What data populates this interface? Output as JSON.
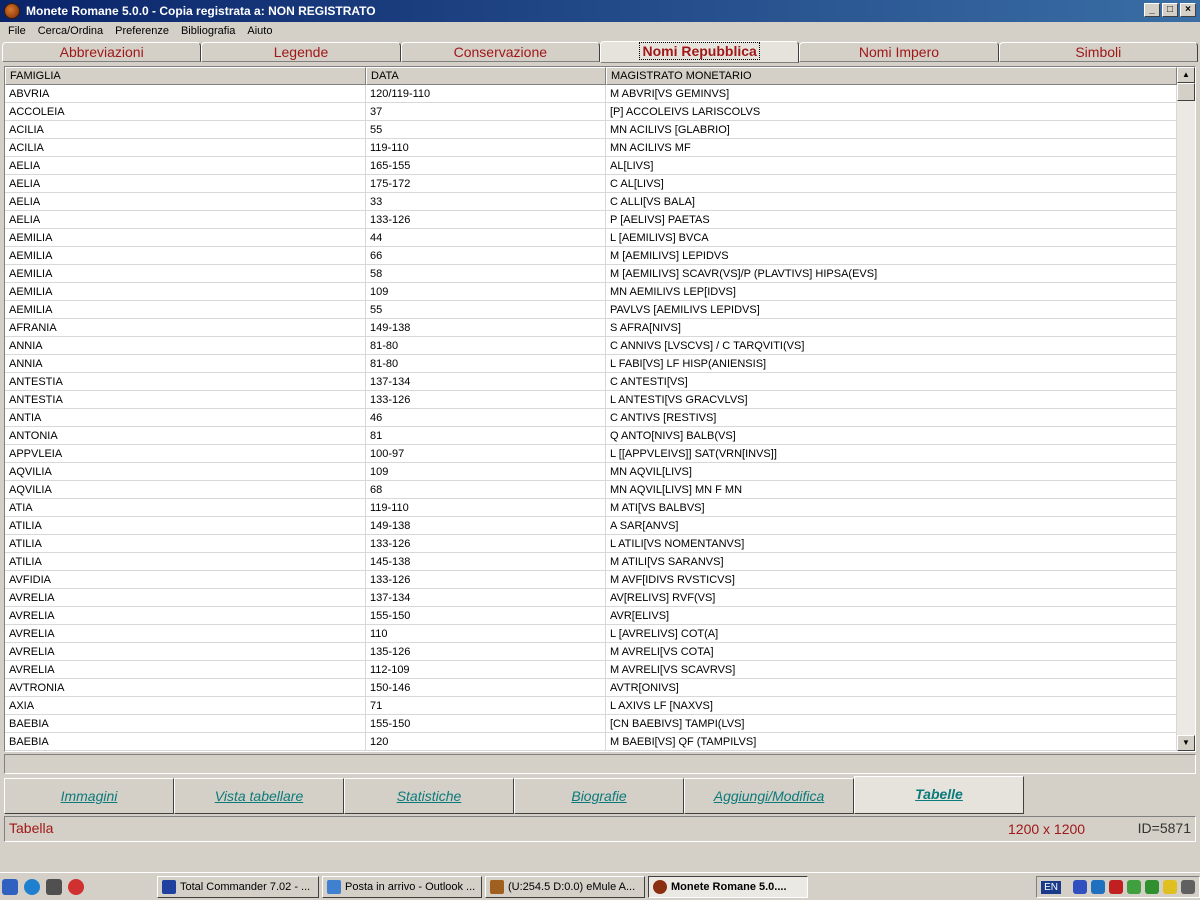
{
  "window": {
    "title": "Monete Romane 5.0.0 - Copia registrata a:  NON REGISTRATO",
    "minimize_label": "0",
    "maximize_label": "1",
    "close_label": "r"
  },
  "menu": [
    "File",
    "Cerca/Ordina",
    "Preferenze",
    "Bibliografia",
    "Aiuto"
  ],
  "top_tabs": [
    "Abbreviazioni",
    "Legende",
    "Conservazione",
    "Nomi Repubblica",
    "Nomi Impero",
    "Simboli"
  ],
  "active_top_tab": "Nomi Repubblica",
  "table": {
    "columns": [
      "FAMIGLIA",
      "DATA",
      "MAGISTRATO MONETARIO"
    ],
    "rows": [
      [
        "ABVRIA",
        "120/119-110",
        "M ABVRI[VS GEMINVS]"
      ],
      [
        "ACCOLEIA",
        "37",
        "[P] ACCOLEIVS LARISCOLVS"
      ],
      [
        "ACILIA",
        "55",
        "MN ACILIVS [GLABRIO]"
      ],
      [
        "ACILIA",
        "119-110",
        "MN ACILIVS MF"
      ],
      [
        "AELIA",
        "165-155",
        "AL[LIVS]"
      ],
      [
        "AELIA",
        "175-172",
        "C AL[LIVS]"
      ],
      [
        "AELIA",
        "33",
        "C ALLI[VS BALA]"
      ],
      [
        "AELIA",
        "133-126",
        "P [AELIVS] PAETAS"
      ],
      [
        "AEMILIA",
        "44",
        "L [AEMILIVS] BVCA"
      ],
      [
        "AEMILIA",
        "66",
        "M [AEMILIVS] LEPIDVS"
      ],
      [
        "AEMILIA",
        "58",
        "M [AEMILIVS] SCAVR(VS]/P (PLAVTIVS] HIPSA(EVS]"
      ],
      [
        "AEMILIA",
        "109",
        "MN AEMILIVS LEP[IDVS]"
      ],
      [
        "AEMILIA",
        "55",
        "PAVLVS [AEMILIVS LEPIDVS]"
      ],
      [
        "AFRANIA",
        "149-138",
        "S AFRA[NIVS]"
      ],
      [
        "ANNIA",
        "81-80",
        "C ANNIVS [LVSCVS] / C TARQVITI(VS]"
      ],
      [
        "ANNIA",
        "81-80",
        "L FABI[VS] LF HISP(ANIENSIS]"
      ],
      [
        "ANTESTIA",
        "137-134",
        "C ANTESTI[VS]"
      ],
      [
        "ANTESTIA",
        "133-126",
        "L ANTESTI[VS GRACVLVS]"
      ],
      [
        "ANTIA",
        "46",
        "C ANTIVS [RESTIVS]"
      ],
      [
        "ANTONIA",
        "81",
        "Q ANTO[NIVS] BALB(VS]"
      ],
      [
        "APPVLEIA",
        "100-97",
        "L [[APPVLEIVS]] SAT(VRN[INVS]]"
      ],
      [
        "AQVILIA",
        "109",
        "MN AQVIL[LIVS]"
      ],
      [
        "AQVILIA",
        "68",
        "MN AQVIL[LIVS] MN F MN"
      ],
      [
        "ATIA",
        "119-110",
        "M ATI[VS BALBVS]"
      ],
      [
        "ATILIA",
        "149-138",
        "A SAR[ANVS]"
      ],
      [
        "ATILIA",
        "133-126",
        "L ATILI[VS NOMENTANVS]"
      ],
      [
        "ATILIA",
        "145-138",
        "M ATILI[VS SARANVS]"
      ],
      [
        "AVFIDIA",
        "133-126",
        "M AVF[IDIVS RVSTICVS]"
      ],
      [
        "AVRELIA",
        "137-134",
        "AV[RELIVS] RVF(VS]"
      ],
      [
        "AVRELIA",
        "155-150",
        "AVR[ELIVS]"
      ],
      [
        "AVRELIA",
        "110",
        "L [AVRELIVS] COT(A]"
      ],
      [
        "AVRELIA",
        "135-126",
        "M AVRELI[VS COTA]"
      ],
      [
        "AVRELIA",
        "112-109",
        "M AVRELI[VS SCAVRVS]"
      ],
      [
        "AVTRONIA",
        "150-146",
        "AVTR[ONIVS]"
      ],
      [
        "AXIA",
        "71",
        "L AXIVS LF [NAXVS]"
      ],
      [
        "BAEBIA",
        "155-150",
        "[CN BAEBIVS] TAMPI(LVS]"
      ],
      [
        "BAEBIA",
        "120",
        "M BAEBI[VS] QF (TAMPILVS]"
      ]
    ]
  },
  "bottom_tabs": [
    "Immagini",
    "Vista tabellare",
    "Statistiche",
    "Biografie",
    "Aggiungi/Modifica",
    "Tabelle"
  ],
  "active_bottom_tab": "Tabelle",
  "status": {
    "left": "Tabella",
    "size": "1200 x 1200",
    "id": "ID=5871"
  },
  "taskbar": {
    "tasks": [
      {
        "label": "Total Commander 7.02 - ...",
        "icon": "floppy-icon",
        "active": false
      },
      {
        "label": "Posta in arrivo - Outlook ...",
        "icon": "outlook-icon",
        "active": false
      },
      {
        "label": "(U:254.5 D:0.0) eMule A...",
        "icon": "emule-icon",
        "active": false
      },
      {
        "label": "Monete Romane 5.0....",
        "icon": "coin-icon",
        "active": true
      }
    ],
    "language": "EN"
  },
  "colors": {
    "tab_text": "#a01818",
    "bottom_tab_text": "#0b7a7a",
    "title_bar": "#0a246a"
  }
}
